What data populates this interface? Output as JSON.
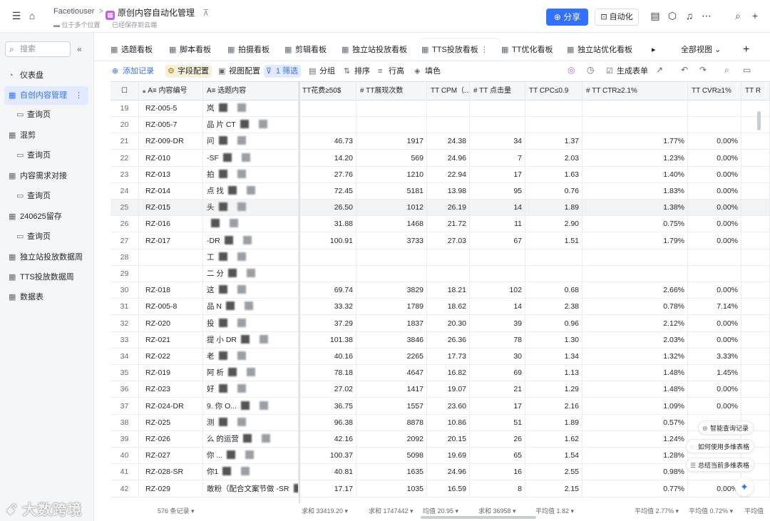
{
  "topbar": {
    "breadcrumb_root": "Facetiouser",
    "breadcrumb_sep": ">",
    "doc_title": "原创内容自动化管理",
    "location_note": "位于多个位置",
    "save_status": "已经保存到云端",
    "share_label": "分享",
    "automation_label": "自动化"
  },
  "sidebar": {
    "search_placeholder": "搜索",
    "items": [
      {
        "label": "仪表盘",
        "icon": "dashboard-icon",
        "child": false,
        "active": false
      },
      {
        "label": "自创内容管理",
        "icon": "table-icon",
        "child": false,
        "active": true
      },
      {
        "label": "查询页",
        "icon": "form-icon",
        "child": true,
        "active": false
      },
      {
        "label": "混剪",
        "icon": "table-icon",
        "child": false,
        "active": false
      },
      {
        "label": "查询页",
        "icon": "form-icon",
        "child": true,
        "active": false
      },
      {
        "label": "内容需求对接",
        "icon": "table-icon",
        "child": false,
        "active": false
      },
      {
        "label": "查询页",
        "icon": "form-icon",
        "child": true,
        "active": false
      },
      {
        "label": "240625留存",
        "icon": "table-icon",
        "child": false,
        "active": false
      },
      {
        "label": "查询页",
        "icon": "form-icon",
        "child": true,
        "active": false
      },
      {
        "label": "独立站投放数据周",
        "icon": "table-icon",
        "child": false,
        "active": false
      },
      {
        "label": "TTS投放数据周",
        "icon": "table-icon",
        "child": false,
        "active": false
      },
      {
        "label": "数据表",
        "icon": "table-icon",
        "child": false,
        "active": false
      }
    ]
  },
  "tabs": [
    "选题看板",
    "脚本看板",
    "拍摄看板",
    "剪辑看板",
    "独立站投放看板",
    "TTS投放看板",
    "TT优化看板",
    "独立站优化看板"
  ],
  "active_tab_index": 5,
  "all_views_label": "全部视图",
  "toolbar": {
    "add_record": "添加记录",
    "field_config": "字段配置",
    "view_config": "视图配置",
    "filter": "1 筛选",
    "group": "分组",
    "sort": "排序",
    "row_height": "行高",
    "fill_color": "填色",
    "generate_form": "生成表单"
  },
  "grid": {
    "headers": [
      "A≡ 内容编号",
      "A≡ 选题内容",
      "TT花费≥50$",
      "# TT展现次数",
      "TT CPM（...",
      "# TT 点击量",
      "TT CPC≤0.9",
      "# TT CTR≥2.1%",
      "TT CVR≥1%",
      "TT R"
    ],
    "rows": [
      {
        "idx": "19",
        "code": "RZ-005-5",
        "name": "岚",
        "spend": "",
        "impr": "",
        "cpm": "",
        "clicks": "",
        "cpc": "",
        "ctr": "",
        "cvr": ""
      },
      {
        "idx": "20",
        "code": "RZ-005-7",
        "name": "品       片   CT",
        "spend": "",
        "impr": "",
        "cpm": "",
        "clicks": "",
        "cpc": "",
        "ctr": "",
        "cvr": ""
      },
      {
        "idx": "21",
        "code": "RZ-009-DR",
        "name": "问",
        "spend": "46.73",
        "impr": "1917",
        "cpm": "24.38",
        "clicks": "34",
        "cpc": "1.37",
        "ctr": "1.77%",
        "cvr": "0.00%"
      },
      {
        "idx": "22",
        "code": "RZ-010",
        "name": "-SF",
        "spend": "14.20",
        "impr": "569",
        "cpm": "24.96",
        "clicks": "7",
        "cpc": "2.03",
        "ctr": "1.23%",
        "cvr": "0.00%"
      },
      {
        "idx": "23",
        "code": "RZ-013",
        "name": "拍",
        "spend": "27.76",
        "impr": "1210",
        "cpm": "22.94",
        "clicks": "17",
        "cpc": "1.63",
        "ctr": "1.40%",
        "cvr": "0.00%"
      },
      {
        "idx": "24",
        "code": "RZ-014",
        "name": "点          找",
        "spend": "72.45",
        "impr": "5181",
        "cpm": "13.98",
        "clicks": "95",
        "cpc": "0.76",
        "ctr": "1.83%",
        "cvr": "0.00%"
      },
      {
        "idx": "25",
        "code": "RZ-015",
        "name": "头",
        "spend": "26.50",
        "impr": "1012",
        "cpm": "26.19",
        "clicks": "14",
        "cpc": "1.89",
        "ctr": "1.38%",
        "cvr": "0.00%"
      },
      {
        "idx": "26",
        "code": "RZ-016",
        "name": "",
        "spend": "31.88",
        "impr": "1468",
        "cpm": "21.72",
        "clicks": "11",
        "cpc": "2.90",
        "ctr": "0.75%",
        "cvr": "0.00%"
      },
      {
        "idx": "27",
        "code": "RZ-017",
        "name": "        -DR",
        "spend": "100.91",
        "impr": "3733",
        "cpm": "27.03",
        "clicks": "67",
        "cpc": "1.51",
        "ctr": "1.79%",
        "cvr": "0.00%"
      },
      {
        "idx": "28",
        "code": "",
        "name": "工",
        "spend": "",
        "impr": "",
        "cpm": "",
        "clicks": "",
        "cpc": "",
        "ctr": "",
        "cvr": ""
      },
      {
        "idx": "29",
        "code": "",
        "name": "二  分",
        "spend": "",
        "impr": "",
        "cpm": "",
        "clicks": "",
        "cpc": "",
        "ctr": "",
        "cvr": ""
      },
      {
        "idx": "30",
        "code": "RZ-018",
        "name": "这",
        "spend": "69.74",
        "impr": "3829",
        "cpm": "18.21",
        "clicks": "102",
        "cpc": "0.68",
        "ctr": "2.66%",
        "cvr": "0.00%"
      },
      {
        "idx": "31",
        "code": "RZ-005-8",
        "name": "品     N",
        "spend": "33.32",
        "impr": "1789",
        "cpm": "18.62",
        "clicks": "14",
        "cpc": "2.38",
        "ctr": "0.78%",
        "cvr": "7.14%"
      },
      {
        "idx": "32",
        "code": "RZ-020",
        "name": "投",
        "spend": "37.29",
        "impr": "1837",
        "cpm": "20.30",
        "clicks": "39",
        "cpc": "0.96",
        "ctr": "2.12%",
        "cvr": "0.00%"
      },
      {
        "idx": "33",
        "code": "RZ-021",
        "name": "提        小    DR",
        "spend": "101.38",
        "impr": "3846",
        "cpm": "26.36",
        "clicks": "78",
        "cpc": "1.30",
        "ctr": "2.03%",
        "cvr": "0.00%"
      },
      {
        "idx": "34",
        "code": "RZ-022",
        "name": "老",
        "spend": "40.16",
        "impr": "2265",
        "cpm": "17.73",
        "clicks": "30",
        "cpc": "1.34",
        "ctr": "1.32%",
        "cvr": "3.33%"
      },
      {
        "idx": "35",
        "code": "RZ-019",
        "name": "阿    析",
        "spend": "78.18",
        "impr": "4647",
        "cpm": "16.82",
        "clicks": "69",
        "cpc": "1.13",
        "ctr": "1.48%",
        "cvr": "1.45%"
      },
      {
        "idx": "36",
        "code": "RZ-023",
        "name": "好",
        "spend": "27.02",
        "impr": "1417",
        "cpm": "19.07",
        "clicks": "21",
        "cpc": "1.29",
        "ctr": "1.48%",
        "cvr": "0.00%"
      },
      {
        "idx": "37",
        "code": "RZ-024-DR",
        "name": "9.          你    O...",
        "spend": "36.75",
        "impr": "1557",
        "cpm": "23.60",
        "clicks": "17",
        "cpc": "2.16",
        "ctr": "1.09%",
        "cvr": "0.00%"
      },
      {
        "idx": "38",
        "code": "RZ-025",
        "name": "测",
        "spend": "96.38",
        "impr": "8878",
        "cpm": "10.86",
        "clicks": "51",
        "cpc": "1.89",
        "ctr": "0.57%",
        "cvr": ""
      },
      {
        "idx": "39",
        "code": "RZ-026",
        "name": "么        的运营",
        "spend": "42.16",
        "impr": "2092",
        "cpm": "20.15",
        "clicks": "26",
        "cpc": "1.62",
        "ctr": "1.24%",
        "cvr": ""
      },
      {
        "idx": "40",
        "code": "RZ-027",
        "name": "你           ...",
        "spend": "100.37",
        "impr": "5098",
        "cpm": "19.69",
        "clicks": "65",
        "cpc": "1.54",
        "ctr": "1.28%",
        "cvr": ""
      },
      {
        "idx": "41",
        "code": "RZ-028-SR",
        "name": "你1",
        "spend": "40.81",
        "impr": "1635",
        "cpm": "24.96",
        "clicks": "16",
        "cpc": "2.55",
        "ctr": "0.98%",
        "cvr": ""
      },
      {
        "idx": "42",
        "code": "RZ-029",
        "name": "敢粉（配合文案节做   -SR",
        "spend": "17.17",
        "impr": "1035",
        "cpm": "16.59",
        "clicks": "8",
        "cpc": "2.15",
        "ctr": "0.77%",
        "cvr": "0.00%"
      }
    ]
  },
  "footer": {
    "record_count": "576 条记录",
    "sum_spend": "求和 33419.20",
    "sum_impr": "求和 1747442",
    "avg_cpm": "均值 20.95",
    "sum_clicks": "求和 36958",
    "avg_cpc": "平均值 1.82",
    "avg_ctr": "平均值 2.77%",
    "avg_cvr": "平均值 0.72%",
    "avg_last": "平均值"
  },
  "ai_panel": {
    "smart_query": "智能查询记录",
    "how_to_use": "如何使用多维表格",
    "summarize": "总结当前多维表格"
  },
  "watermark": "大数跨境",
  "colors": {
    "accent": "#3370ff",
    "active_bg": "#e1eaff",
    "field_config_bg": "#f7f0d9"
  }
}
